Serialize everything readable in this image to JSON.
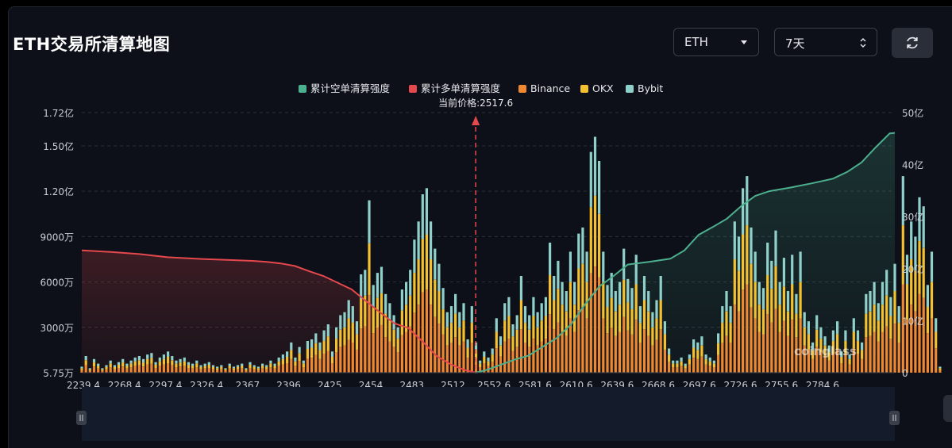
{
  "header": {
    "title": "ETH交易所清算地图",
    "symbol_select": "ETH",
    "range_select": "7天"
  },
  "colors": {
    "short_cum": "#4caf8e",
    "long_cum": "#e5484d",
    "binance": "#f0882f",
    "okx": "#f5c02e",
    "bybit": "#8fd0ca",
    "current_price": "#e5484d"
  },
  "icons": [
    "chevron-down-icon",
    "up-down-icon",
    "refresh-icon",
    "slider-handle-icon"
  ],
  "watermark": "coinglass",
  "chart_data": {
    "type": "bar",
    "legend": [
      {
        "name": "累计空单清算强度",
        "color": "#4caf8e"
      },
      {
        "name": "累计多单清算强度",
        "color": "#e5484d"
      },
      {
        "name": "Binance",
        "color": "#f0882f"
      },
      {
        "name": "OKX",
        "color": "#f5c02e"
      },
      {
        "name": "Bybit",
        "color": "#8fd0ca"
      }
    ],
    "legend_position": "top-center",
    "current_price_label": "当前价格:2517.6",
    "current_price": 2517.6,
    "x_ticks": [
      "2239.4",
      "2268.4",
      "2297.4",
      "2326.4",
      "2367",
      "2396",
      "2425",
      "2454",
      "2483",
      "2512",
      "2552.6",
      "2581.6",
      "2610.6",
      "2639.6",
      "2668.6",
      "2697.6",
      "2726.6",
      "2755.6",
      "2784.6"
    ],
    "x_range": [
      2239.4,
      2813.6
    ],
    "y_left_ticks": [
      "5.75万",
      "3000万",
      "6000万",
      "9000万",
      "1.20亿",
      "1.50亿",
      "1.72亿"
    ],
    "y_left_values": [
      57500,
      30000000,
      60000000,
      90000000,
      120000000,
      150000000,
      172000000
    ],
    "y_left_range": [
      0,
      172000000
    ],
    "y_right_ticks": [
      "0",
      "10亿",
      "20亿",
      "30亿",
      "40亿",
      "50亿"
    ],
    "y_right_range": [
      0,
      5000000000
    ],
    "grid": "horizontal-dashed",
    "bar_step": 2.9,
    "bar_start": 2239.4,
    "bars_total_millions": [
      4,
      11,
      3,
      9,
      6,
      3,
      5,
      8,
      5,
      7,
      9,
      6,
      8,
      10,
      11,
      9,
      12,
      13,
      7,
      10,
      12,
      14,
      11,
      8,
      9,
      10,
      7,
      6,
      8,
      5,
      6,
      7,
      5,
      4,
      5,
      3,
      6,
      4,
      5,
      6,
      3,
      7,
      5,
      4,
      6,
      5,
      8,
      6,
      10,
      12,
      14,
      20,
      10,
      17,
      8,
      21,
      22,
      26,
      20,
      28,
      32,
      14,
      30,
      38,
      40,
      48,
      44,
      34,
      65,
      68,
      114,
      58,
      66,
      70,
      52,
      46,
      38,
      30,
      55,
      60,
      68,
      88,
      100,
      118,
      122,
      100,
      82,
      72,
      56,
      40,
      44,
      52,
      40,
      46,
      22,
      44,
      20,
      8,
      14,
      10,
      16,
      36,
      24,
      46,
      50,
      32,
      38,
      64,
      44,
      38,
      50,
      40,
      46,
      50,
      86,
      64,
      74,
      60,
      54,
      80,
      60,
      92,
      96,
      80,
      146,
      156,
      140,
      80,
      58,
      66,
      54,
      60,
      82,
      62,
      56,
      78,
      44,
      64,
      54,
      40,
      48,
      64,
      34,
      16,
      8,
      8,
      10,
      6,
      12,
      22,
      20,
      24,
      12,
      10,
      8,
      26,
      44,
      54,
      44,
      100,
      90,
      122,
      130,
      96,
      80,
      60,
      56,
      86,
      74,
      94,
      60,
      76,
      54,
      78,
      52,
      80,
      40,
      34,
      20,
      38,
      30,
      24,
      18,
      28,
      34,
      14,
      28,
      12,
      36,
      28,
      20,
      52,
      54,
      60,
      46,
      60,
      68,
      50,
      72,
      44,
      130,
      78,
      100,
      90,
      116,
      110,
      58,
      80,
      36,
      4
    ],
    "cum_long": {
      "unit": "亿",
      "points": [
        [
          2239.4,
          23.5
        ],
        [
          2260,
          23.2
        ],
        [
          2280,
          22.8
        ],
        [
          2300,
          22.2
        ],
        [
          2320,
          21.9
        ],
        [
          2340,
          21.7
        ],
        [
          2360,
          21.5
        ],
        [
          2370,
          21.3
        ],
        [
          2380,
          21.0
        ],
        [
          2390,
          20.5
        ],
        [
          2400,
          19.5
        ],
        [
          2410,
          18.6
        ],
        [
          2420,
          17.3
        ],
        [
          2430,
          16.0
        ],
        [
          2440,
          13.8
        ],
        [
          2450,
          11.6
        ],
        [
          2460,
          9.5
        ],
        [
          2470,
          8.6
        ],
        [
          2480,
          6.0
        ],
        [
          2490,
          3.2
        ],
        [
          2500,
          1.6
        ],
        [
          2510,
          0.5
        ],
        [
          2517.6,
          0
        ]
      ]
    },
    "cum_short": {
      "unit": "亿",
      "points": [
        [
          2517.6,
          0
        ],
        [
          2525,
          0.5
        ],
        [
          2535,
          1.5
        ],
        [
          2545,
          2.5
        ],
        [
          2555,
          3.3
        ],
        [
          2565,
          5.0
        ],
        [
          2575,
          6.7
        ],
        [
          2585,
          9.3
        ],
        [
          2595,
          13.2
        ],
        [
          2605,
          16.6
        ],
        [
          2615,
          18.6
        ],
        [
          2625,
          20.8
        ],
        [
          2640,
          21.3
        ],
        [
          2655,
          21.9
        ],
        [
          2665,
          23.5
        ],
        [
          2675,
          26.5
        ],
        [
          2685,
          28.0
        ],
        [
          2695,
          29.6
        ],
        [
          2705,
          32.0
        ],
        [
          2715,
          34.0
        ],
        [
          2725,
          34.9
        ],
        [
          2740,
          35.6
        ],
        [
          2755,
          36.4
        ],
        [
          2770,
          37.3
        ],
        [
          2780,
          38.6
        ],
        [
          2790,
          40.4
        ],
        [
          2800,
          43.3
        ],
        [
          2810,
          46.0
        ],
        [
          2813.6,
          46.1
        ]
      ]
    }
  }
}
